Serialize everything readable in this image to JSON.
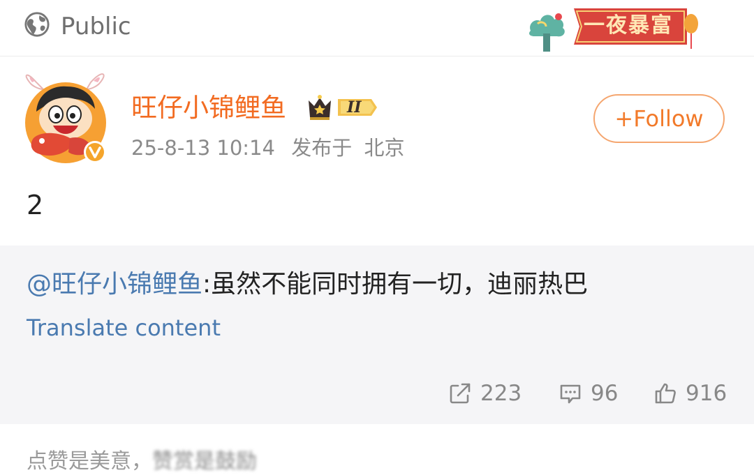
{
  "header": {
    "visibility_label": "Public",
    "promo_text": "一夜暴富",
    "icons": {
      "visibility": "globe-icon",
      "promo": "festive-banner-icon"
    }
  },
  "post": {
    "author_name": "旺仔小锦鲤鱼",
    "level_badge": "II",
    "verified": true,
    "timestamp": "25-8-13 10:14",
    "location_prefix": "发布于",
    "location": "北京",
    "follow_label": "+Follow",
    "text": "2"
  },
  "repost": {
    "mention": "@旺仔小锦鲤鱼",
    "body": ":虽然不能同时拥有一切，迪丽热巴",
    "translate_label": "Translate content",
    "stats": {
      "reposts": "223",
      "comments": "96",
      "likes": "916"
    }
  },
  "footer": {
    "text": "点赞是美意，",
    "blurred_text": "赞赏是鼓励"
  },
  "colors": {
    "author": "#f26b21",
    "link": "#4a7ab0",
    "follow_border": "#f5a66f",
    "card_bg": "#f5f5f7"
  }
}
